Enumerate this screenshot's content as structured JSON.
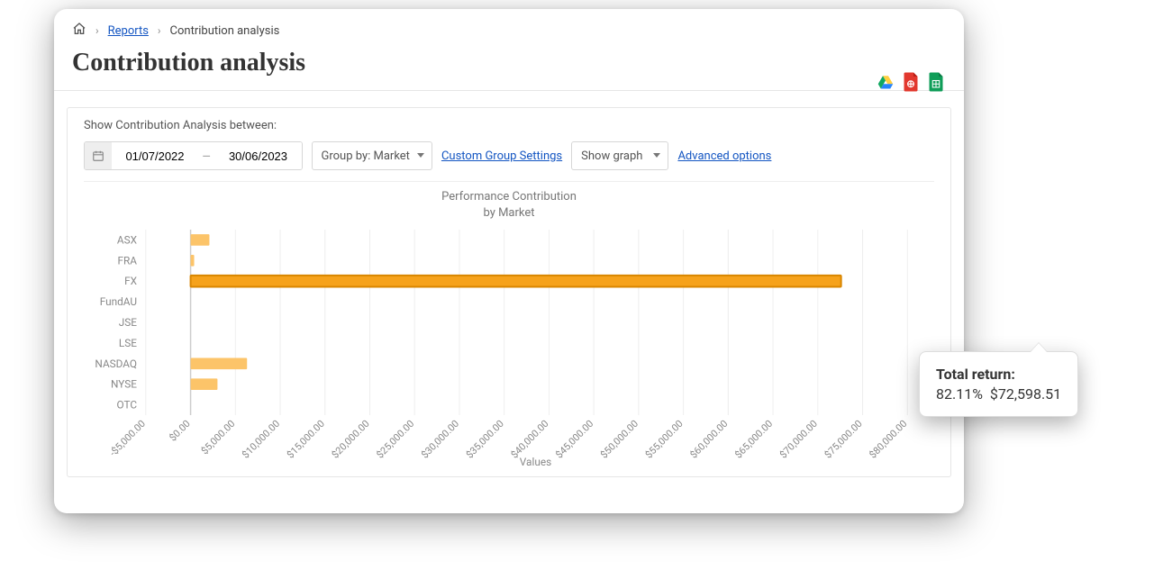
{
  "breadcrumb": {
    "reports": "Reports",
    "current": "Contribution analysis"
  },
  "page_title": "Contribution analysis",
  "export_icons": {
    "drive": "google-drive-icon",
    "pdf": "pdf-icon",
    "sheets": "google-sheets-icon"
  },
  "filters": {
    "label": "Show Contribution Analysis between:",
    "date_from": "01/07/2022",
    "date_to": "30/06/2023",
    "group_by_label": "Group by: Market",
    "custom_group_link": "Custom Group Settings",
    "show_select": "Show graph",
    "advanced_link": "Advanced options"
  },
  "chart_header": {
    "title": "Performance Contribution",
    "subtitle": "by Market"
  },
  "tooltip": {
    "label": "Total return:",
    "percent": "82.11%",
    "amount": "$72,598.51"
  },
  "chart_data": {
    "type": "bar",
    "orientation": "horizontal",
    "title": "Performance Contribution by Market",
    "xlabel": "Values",
    "ylabel": "",
    "x_ticks": [
      "-$5,000.00",
      "$0.00",
      "$5,000.00",
      "$10,000.00",
      "$15,000.00",
      "$20,000.00",
      "$25,000.00",
      "$30,000.00",
      "$35,000.00",
      "$40,000.00",
      "$45,000.00",
      "$50,000.00",
      "$55,000.00",
      "$60,000.00",
      "$65,000.00",
      "$70,000.00",
      "$75,000.00",
      "$80,000.00"
    ],
    "xlim": [
      -5000,
      82000
    ],
    "categories": [
      "ASX",
      "FRA",
      "FX",
      "FundAU",
      "JSE",
      "LSE",
      "NASDAQ",
      "NYSE",
      "OTC"
    ],
    "values": [
      2100,
      400,
      72598.51,
      0,
      0,
      0,
      6300,
      3000,
      0
    ],
    "highlight_index": 2
  }
}
